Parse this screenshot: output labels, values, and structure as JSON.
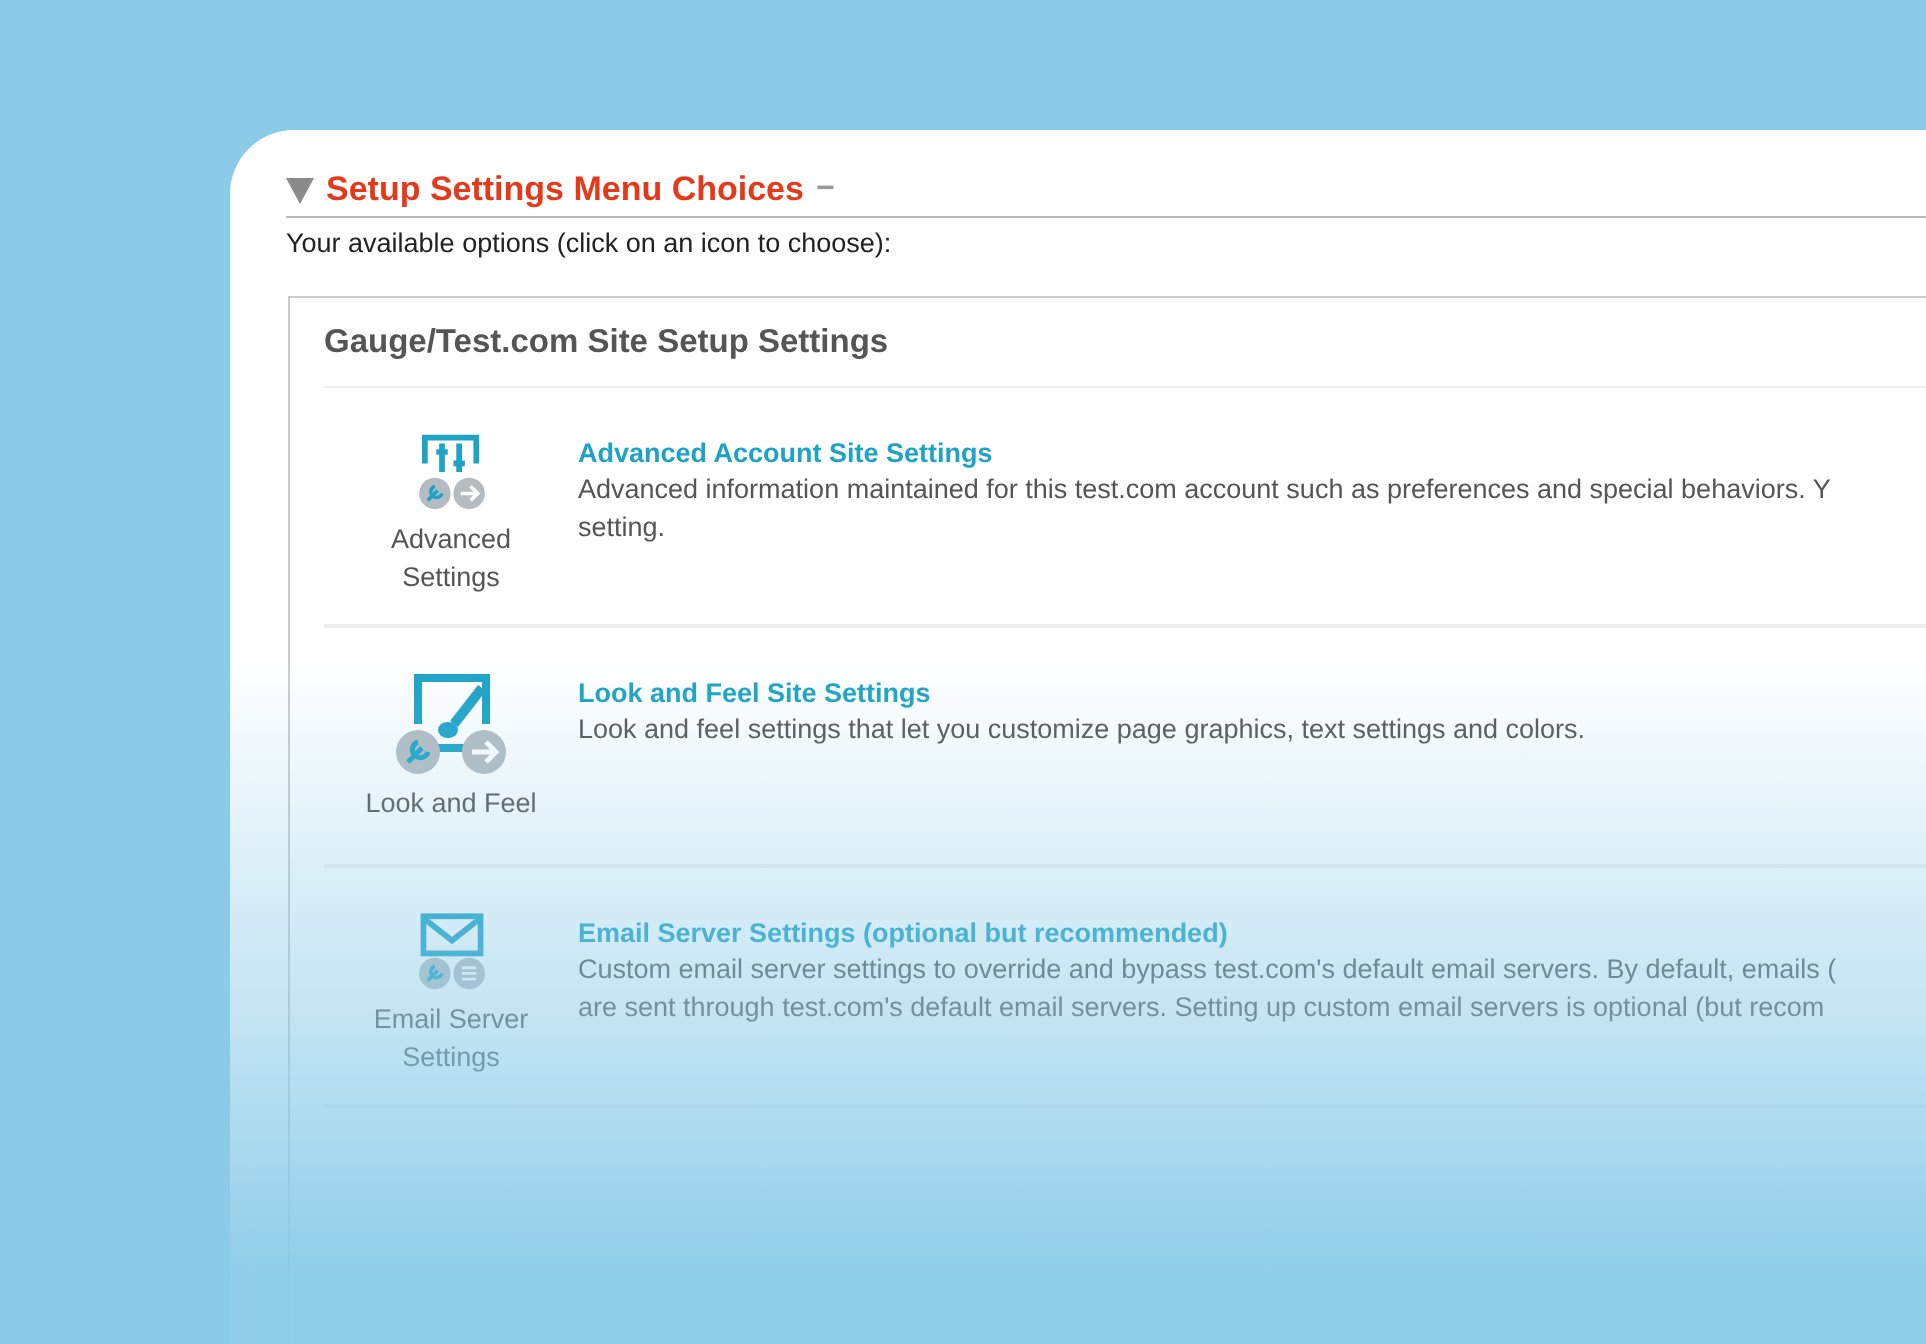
{
  "section": {
    "title": "Setup Settings Menu Choices",
    "collapse": "−",
    "instructions": "Your available options (click on an icon to choose):"
  },
  "group": {
    "title": "Gauge/Test.com Site Setup Settings",
    "options": [
      {
        "kind": "sliders",
        "caption": [
          "Advanced",
          "Settings"
        ],
        "title": "Advanced Account Site Settings",
        "lines": [
          "Advanced information maintained for this test.com account such as preferences and special behaviors. Y",
          "setting."
        ]
      },
      {
        "kind": "brush",
        "caption": [
          "Look and Feel"
        ],
        "title": "Look and Feel Site Settings",
        "lines": [
          "Look and feel settings that let you customize page graphics, text settings and colors."
        ]
      },
      {
        "kind": "envelope",
        "caption": [
          "Email Server",
          "Settings"
        ],
        "title": "Email Server Settings (optional but recommended)",
        "lines": [
          "Custom email server settings to override and bypass test.com's default email servers. By default, emails (",
          "are sent through test.com's default email servers. Setting up custom email servers is optional (but recom"
        ]
      }
    ]
  }
}
